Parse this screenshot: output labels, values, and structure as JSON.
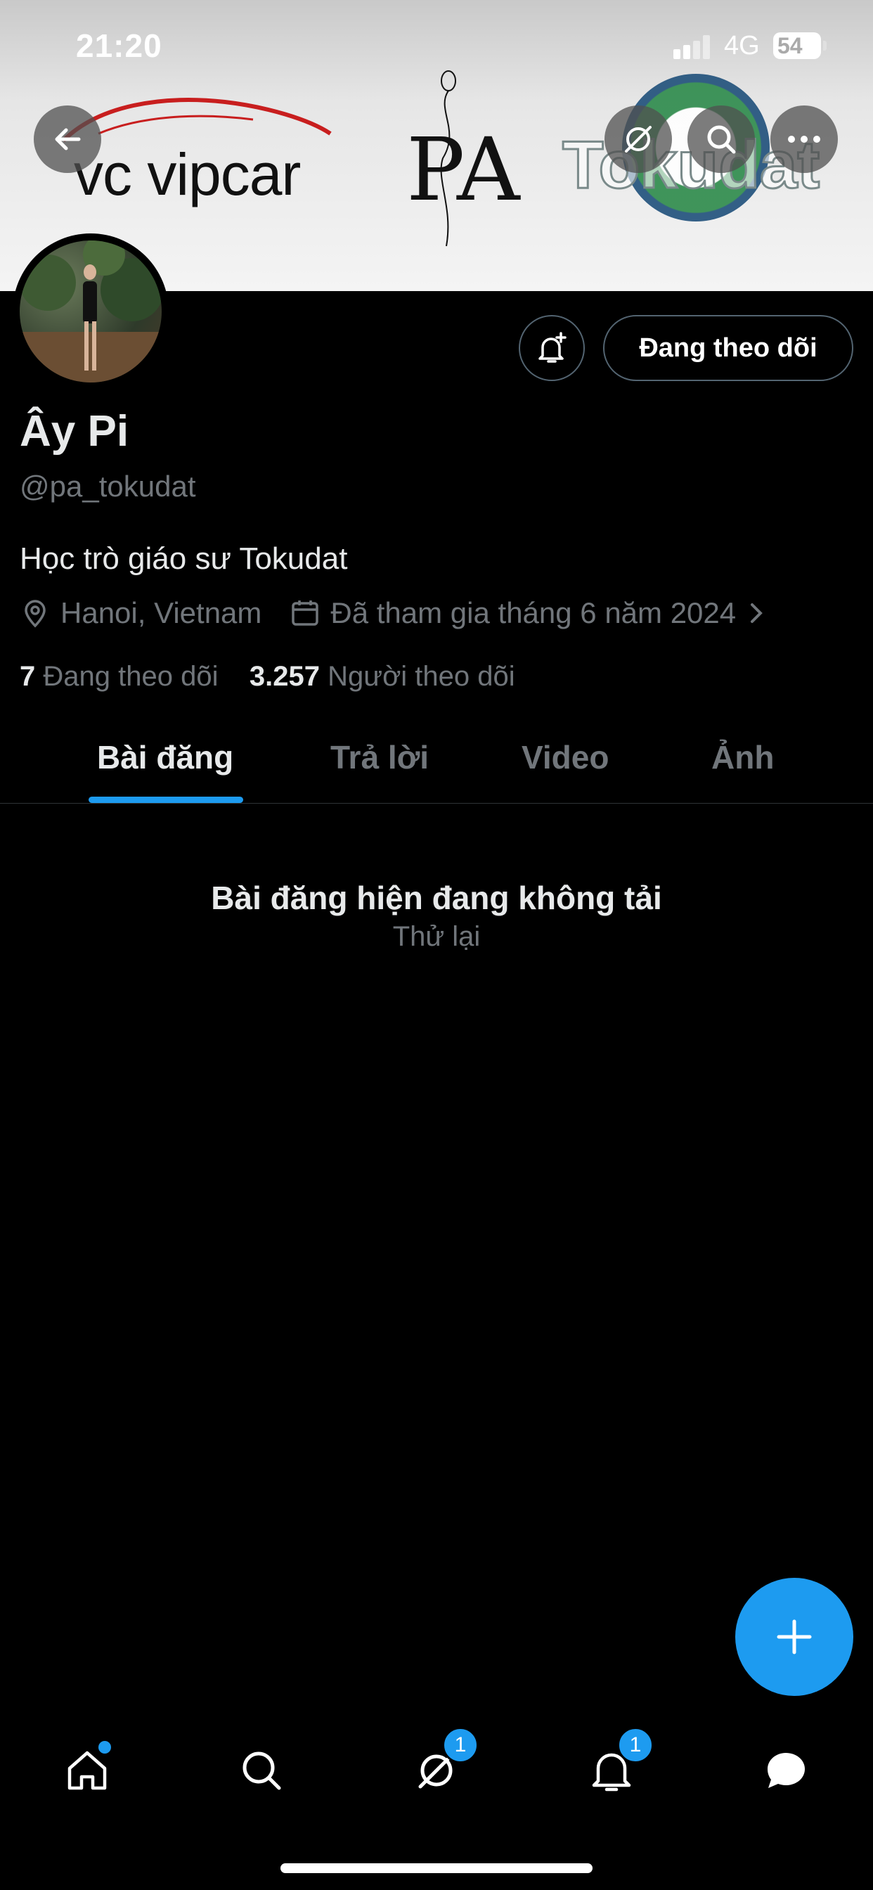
{
  "status_bar": {
    "time": "21:20",
    "network": "4G",
    "battery": "54"
  },
  "banner": {
    "logo_left": "vc vipcar",
    "logo_center": "PA",
    "logo_right": "Tokudat"
  },
  "profile": {
    "name": "Ây Pi",
    "handle": "@pa_tokudat",
    "bio": "Học trò giáo sư Tokudat",
    "location": "Hanoi, Vietnam",
    "joined": "Đã tham gia tháng 6 năm 2024",
    "following_count": "7",
    "following_label": "Đang theo dõi",
    "followers_count": "3.257",
    "followers_label": "Người theo dõi",
    "follow_button": "Đang theo dõi"
  },
  "tabs": [
    {
      "label": "Bài đăng",
      "active": true
    },
    {
      "label": "Trả lời",
      "active": false
    },
    {
      "label": "Video",
      "active": false
    },
    {
      "label": "Ảnh",
      "active": false
    }
  ],
  "error": {
    "title": "Bài đăng hiện đang không tải",
    "retry": "Thử lại"
  },
  "nav": {
    "grok_badge": "1",
    "notifications_badge": "1"
  },
  "colors": {
    "accent": "#1d9bf0",
    "background": "#000000",
    "muted": "#71767b"
  }
}
